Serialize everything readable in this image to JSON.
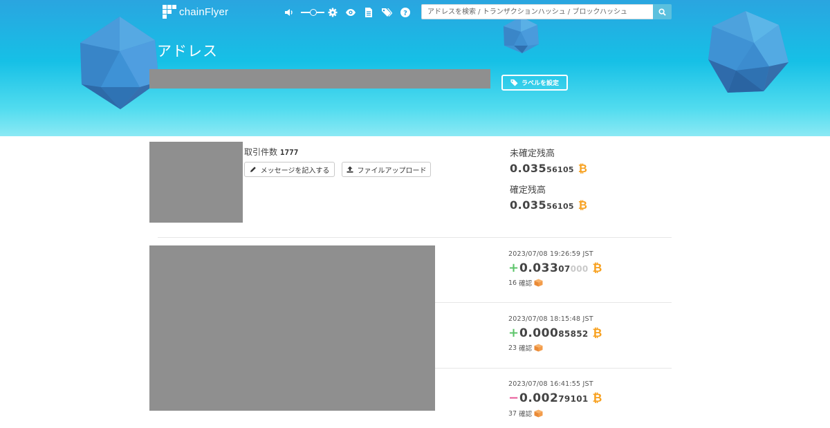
{
  "header": {
    "logo_text": "chainFlyer",
    "search_placeholder": "アドレスを検索 / トランザクションハッシュ / ブロックハッシュ",
    "icons": [
      "volume-icon",
      "slider",
      "gear-icon",
      "eye-icon",
      "document-icon",
      "tags-icon",
      "help-icon",
      "search-icon"
    ]
  },
  "hero": {
    "title": "アドレス",
    "label_button": "ラベルを設定"
  },
  "summary": {
    "tx_count_label": "取引件数",
    "tx_count_value": "1777",
    "message_button": "メッセージを記入する",
    "upload_button": "ファイルアップロード",
    "unconfirmed_label": "未確定残高",
    "unconfirmed_big": "0.035",
    "unconfirmed_small": "56105",
    "confirmed_label": "確定残高",
    "confirmed_big": "0.035",
    "confirmed_small": "56105",
    "currency_symbol": "₿"
  },
  "transactions": [
    {
      "date": "2023/07/08 19:26:59 JST",
      "sign": "+",
      "big": "0.033",
      "small": "07",
      "faded": "000",
      "confirmations": "16",
      "confirm_label": "確認"
    },
    {
      "date": "2023/07/08 18:15:48 JST",
      "sign": "+",
      "big": "0.000",
      "small": "85852",
      "faded": "",
      "confirmations": "23",
      "confirm_label": "確認"
    },
    {
      "date": "2023/07/08 16:41:55 JST",
      "sign": "−",
      "big": "0.002",
      "small": "79101",
      "faded": "",
      "confirmations": "37",
      "confirm_label": "確認"
    }
  ],
  "colors": {
    "hero_top": "#2aa5e0",
    "hero_bottom": "#8be9f4",
    "bitcoin": "#f7a01e",
    "plus": "#5cc46a",
    "minus": "#e85b9a",
    "search_button": "#5bc0de",
    "redacted": "#8f8f8f"
  }
}
